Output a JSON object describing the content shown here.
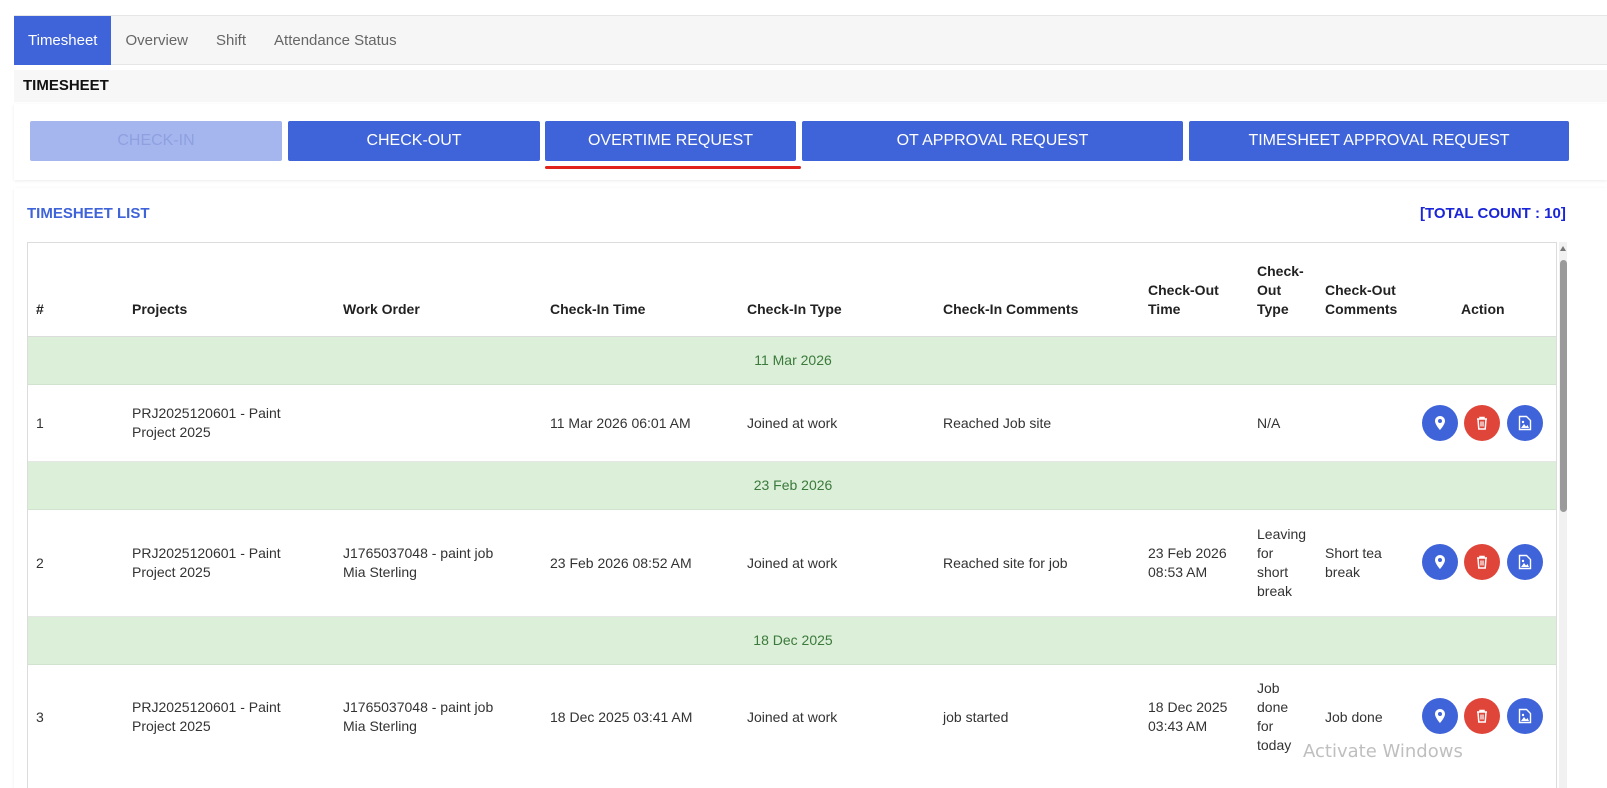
{
  "tabs": [
    {
      "label": "Timesheet"
    },
    {
      "label": "Overview"
    },
    {
      "label": "Shift"
    },
    {
      "label": "Attendance Status"
    }
  ],
  "section_title": "TIMESHEET",
  "buttons": {
    "checkin": "CHECK-IN",
    "checkout": "CHECK-OUT",
    "overtime": "OVERTIME REQUEST",
    "ot_approval": "OT APPROVAL REQUEST",
    "timesheet_approval": "TIMESHEET APPROVAL REQUEST"
  },
  "list": {
    "title": "TIMESHEET LIST",
    "total_count": "[TOTAL COUNT : 10]"
  },
  "columns": {
    "num": "#",
    "projects": "Projects",
    "work_order": "Work Order",
    "checkin_time": "Check-In Time",
    "checkin_type": "Check-In Type",
    "checkin_comments": "Check-In Comments",
    "checkout_time_1": "Check-Out",
    "checkout_time_2": "Time",
    "checkout_type_1": "Check-",
    "checkout_type_2": "Out",
    "checkout_type_3": "Type",
    "checkout_comments_1": "Check-Out",
    "checkout_comments_2": "Comments",
    "action": "Action"
  },
  "groups": [
    {
      "date": "11 Mar 2026",
      "row": {
        "num": "1",
        "project_1": "PRJ2025120601 - Paint",
        "project_2": "Project 2025",
        "wo_1": "",
        "wo_2": "",
        "checkin_time": "11 Mar 2026 06:01 AM",
        "checkin_type": "Joined at work",
        "checkin_comments": "Reached Job site",
        "checkout_time_1": "",
        "checkout_time_2": "",
        "checkout_type": [
          "N/A"
        ],
        "checkout_comments_1": "",
        "checkout_comments_2": ""
      }
    },
    {
      "date": "23 Feb 2026",
      "row": {
        "num": "2",
        "project_1": "PRJ2025120601 - Paint",
        "project_2": "Project 2025",
        "wo_1": "J1765037048 - paint job",
        "wo_2": "Mia Sterling",
        "checkin_time": "23 Feb 2026 08:52 AM",
        "checkin_type": "Joined at work",
        "checkin_comments": "Reached site for job",
        "checkout_time_1": "23 Feb 2026",
        "checkout_time_2": "08:53 AM",
        "checkout_type": [
          "Leaving",
          "for",
          "short",
          "break"
        ],
        "checkout_comments_1": "Short tea",
        "checkout_comments_2": "break"
      }
    },
    {
      "date": "18 Dec 2025",
      "row": {
        "num": "3",
        "project_1": "PRJ2025120601 - Paint",
        "project_2": "Project 2025",
        "wo_1": "J1765037048 - paint job",
        "wo_2": "Mia Sterling",
        "checkin_time": "18 Dec 2025 03:41 AM",
        "checkin_type": "Joined at work",
        "checkin_comments": "job started",
        "checkout_time_1": "18 Dec 2025",
        "checkout_time_2": "03:43 AM",
        "checkout_type": [
          "Job",
          "done",
          "for",
          "today"
        ],
        "checkout_comments_1": "Job done",
        "checkout_comments_2": ""
      }
    }
  ],
  "icons": {
    "location": "map-pin-icon",
    "delete": "trash-icon",
    "image": "image-icon"
  },
  "colors": {
    "primary": "#3f63d8",
    "danger": "#e0453a",
    "group_bg": "#dcefd9",
    "group_text": "#3b7a3b",
    "count": "#1a25d8",
    "underline": "#e0231d"
  },
  "watermark": "Activate Windows"
}
